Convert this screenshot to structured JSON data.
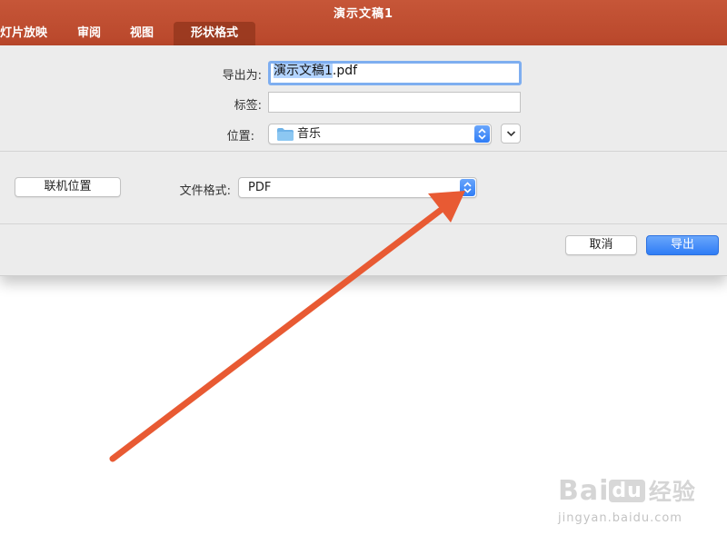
{
  "window": {
    "title": "演示文稿1"
  },
  "ribbon": {
    "tabs": [
      {
        "label": "灯片放映"
      },
      {
        "label": "审阅"
      },
      {
        "label": "视图"
      },
      {
        "label": "形状格式",
        "active": true
      }
    ]
  },
  "export_dialog": {
    "export_as": {
      "label": "导出为:",
      "value_selected": "演示文稿1",
      "value_rest": ".pdf"
    },
    "tags": {
      "label": "标签:",
      "value": ""
    },
    "location": {
      "label": "位置:",
      "value": "音乐",
      "icon": "folder-icon"
    },
    "online_locations_button": "联机位置",
    "file_format": {
      "label": "文件格式:",
      "value": "PDF"
    },
    "cancel_button": "取消",
    "export_button": "导出"
  },
  "annotation": {
    "arrow_color": "#e85a33"
  },
  "watermark": {
    "logo_text": "Bai",
    "logo_du": "du",
    "logo_cn": "经验",
    "url": "jingyan.baidu.com"
  },
  "colors": {
    "ribbon": "#b9472b",
    "active_tab": "#9c3a20",
    "accent_blue": "#2f7df6",
    "sheet": "#ececec"
  }
}
